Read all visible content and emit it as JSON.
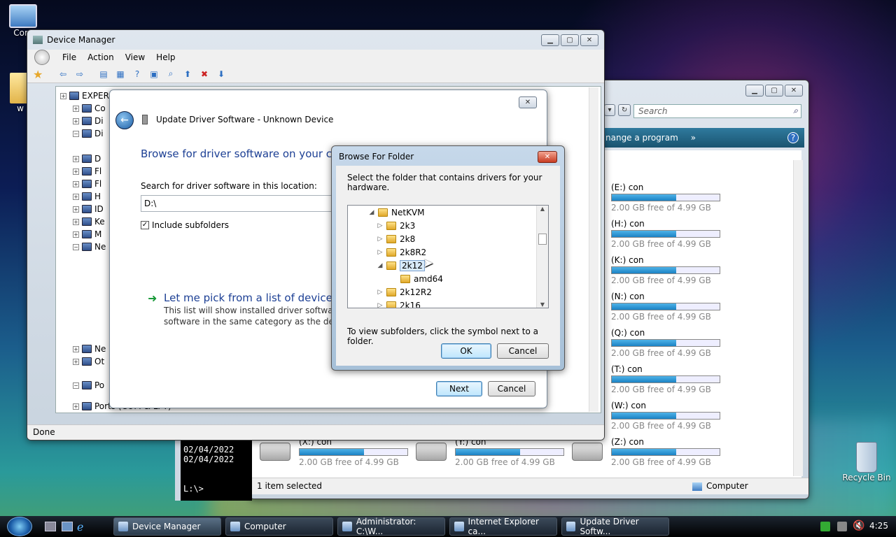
{
  "desktop": {
    "computer_icon_label": "Com",
    "folder_icon_label": "w",
    "recycle_bin_label": "Recycle Bin"
  },
  "device_manager": {
    "title": "Device Manager",
    "menu": [
      "File",
      "Action",
      "View",
      "Help"
    ],
    "tree": [
      {
        "label": "EXPER"
      },
      {
        "label": "Co"
      },
      {
        "label": "Di"
      },
      {
        "label": "Di"
      },
      {
        "label": "D"
      },
      {
        "label": "Fl"
      },
      {
        "label": "Fl"
      },
      {
        "label": "H"
      },
      {
        "label": "ID"
      },
      {
        "label": "Ke"
      },
      {
        "label": "M"
      },
      {
        "label": "Ne"
      },
      {
        "label": "Ne"
      },
      {
        "label": "Ot"
      },
      {
        "label": "Po"
      },
      {
        "label": "Ports (COM & LPT)"
      }
    ],
    "status": "Done"
  },
  "computer_window": {
    "search_placeholder": "Search",
    "command": "nange a program",
    "status": "1 item selected",
    "status_location": "Computer",
    "drives": [
      {
        "label": "(E:) con",
        "free": "2.00 GB free of 4.99 GB",
        "used_fraction": 0.6
      },
      {
        "label": "(H:) con",
        "free": "2.00 GB free of 4.99 GB",
        "used_fraction": 0.6
      },
      {
        "label": "(K:) con",
        "free": "2.00 GB free of 4.99 GB",
        "used_fraction": 0.6
      },
      {
        "label": "(N:) con",
        "free": "2.00 GB free of 4.99 GB",
        "used_fraction": 0.6
      },
      {
        "label": "(Q:) con",
        "free": "2.00 GB free of 4.99 GB",
        "used_fraction": 0.6
      },
      {
        "label": "(T:) con",
        "free": "2.00 GB free of 4.99 GB",
        "used_fraction": 0.6
      },
      {
        "label": "(W:) con",
        "free": "2.00 GB free of 4.99 GB",
        "used_fraction": 0.6
      },
      {
        "label": "(X:) con",
        "free": "2.00 GB free of 4.99 GB",
        "used_fraction": 0.6
      },
      {
        "label": "(Y:) con",
        "free": "2.00 GB free of 4.99 GB",
        "used_fraction": 0.6
      },
      {
        "label": "(Z:) con",
        "free": "2.00 GB free of 4.99 GB",
        "used_fraction": 0.6
      }
    ]
  },
  "cmd": {
    "lines": [
      "02/04/2022",
      "02/04/2022",
      "L:\\>"
    ]
  },
  "update_driver": {
    "title": "Update Driver Software - Unknown Device",
    "heading": "Browse for driver software on your com",
    "search_label": "Search for driver software in this location:",
    "path_value": "D:\\",
    "include_subfolders": "Include subfolders",
    "pick_link": "Let me pick from a list of device dr",
    "pick_desc_1": "This list will show installed driver software co",
    "pick_desc_2": "software in the same category as the device.",
    "next": "Next",
    "cancel": "Cancel"
  },
  "browse_folder": {
    "title": "Browse For Folder",
    "instruction": "Select the folder that contains drivers for your hardware.",
    "items": [
      {
        "label": "NetKVM",
        "expander": "◢"
      },
      {
        "label": "2k3",
        "expander": "▷"
      },
      {
        "label": "2k8",
        "expander": "▷"
      },
      {
        "label": "2k8R2",
        "expander": "▷"
      },
      {
        "label": "2k12",
        "expander": "◢"
      },
      {
        "label": "amd64",
        "expander": ""
      },
      {
        "label": "2k12R2",
        "expander": "▷"
      },
      {
        "label": "2k16",
        "expander": "▷"
      }
    ],
    "hint": "To view subfolders, click the symbol next to a folder.",
    "ok": "OK",
    "cancel": "Cancel"
  },
  "taskbar": {
    "tasks": [
      "Device Manager",
      "Computer",
      "Administrator: C:\\W...",
      "Internet Explorer ca...",
      "Update Driver Softw..."
    ],
    "clock": "4:25"
  }
}
